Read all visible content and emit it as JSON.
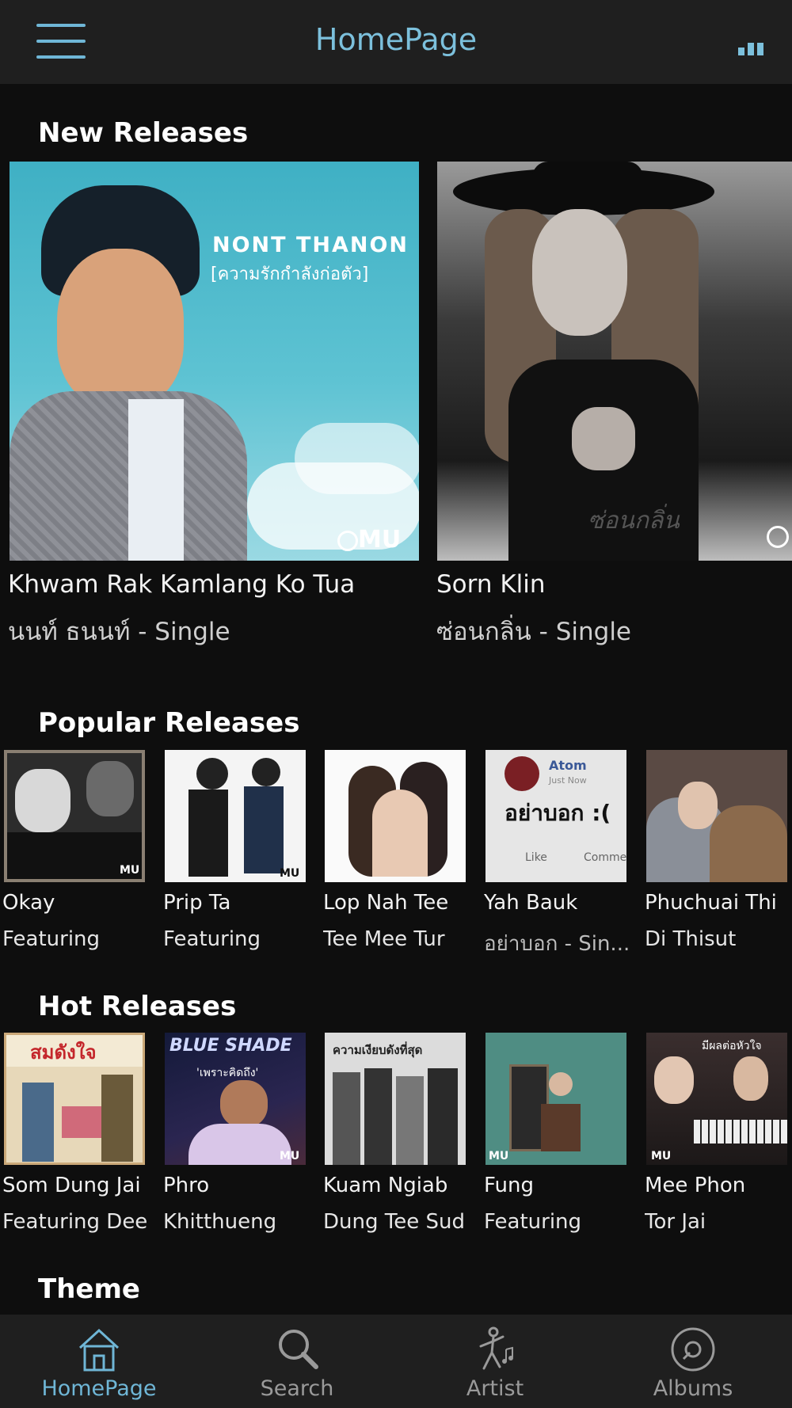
{
  "header": {
    "title": "HomePage"
  },
  "sections": {
    "new": {
      "title": "New Releases"
    },
    "popular": {
      "title": "Popular Releases"
    },
    "hot": {
      "title": "Hot Releases"
    },
    "theme": {
      "title": "Theme"
    }
  },
  "new_releases": [
    {
      "title": "Khwam Rak Kamlang Ko Tua",
      "subtitle": "นนท์ ธนนท์ - Single",
      "cover_heading": "NONT THANON",
      "cover_sub": "[ความรักกำลังก่อตัว]",
      "badge": "MU"
    },
    {
      "title": "Sorn Klin",
      "subtitle": "ซ่อนกลิ่น - Single",
      "cover_script": "ซ่อนกลิ่น"
    }
  ],
  "popular_releases": [
    {
      "line1": "Okay",
      "line2": "Featuring",
      "badge": "MU"
    },
    {
      "line1": "Prip Ta",
      "line2": "Featuring",
      "badge": "MU"
    },
    {
      "line1": "Lop Nah Tee",
      "line2": "Tee Mee Tur"
    },
    {
      "line1": "Yah Bauk",
      "line2": "อย่าบอก - Sin...",
      "post_name": "Atom",
      "post_time": "Just Now",
      "post_text": "อย่าบอก :(",
      "like": "Like",
      "comment": "Comme"
    },
    {
      "line1": "Phuchuai Thi",
      "line2": "Di Thisut"
    }
  ],
  "hot_releases": [
    {
      "line1": "Som Dung Jai",
      "line2": "Featuring Dee",
      "cover_text": "สมดังใจ"
    },
    {
      "line1": "Phro",
      "line2": "Khitthueng",
      "cover_text": "BLUE SHADE",
      "cover_sub": "'เพราะคิดถึง'",
      "badge": "MU"
    },
    {
      "line1": "Kuam Ngiab",
      "line2": "Dung Tee Sud",
      "cover_text": "ความเงียบดังที่สุด"
    },
    {
      "line1": "Fung",
      "line2": "Featuring",
      "badge": "MU"
    },
    {
      "line1": "Mee Phon",
      "line2": "Tor Jai",
      "cover_text": "มีผลต่อหัวใจ",
      "badge": "MU"
    }
  ],
  "tabs": [
    {
      "label": "HomePage",
      "icon": "home-icon",
      "active": true
    },
    {
      "label": "Search",
      "icon": "search-icon",
      "active": false
    },
    {
      "label": "Artist",
      "icon": "artist-icon",
      "active": false
    },
    {
      "label": "Albums",
      "icon": "albums-icon",
      "active": false
    }
  ],
  "colors": {
    "accent": "#7cc0dc",
    "bar": "#1f1f1f",
    "background": "#0e0e0e",
    "inactive": "#9a9a9a"
  }
}
